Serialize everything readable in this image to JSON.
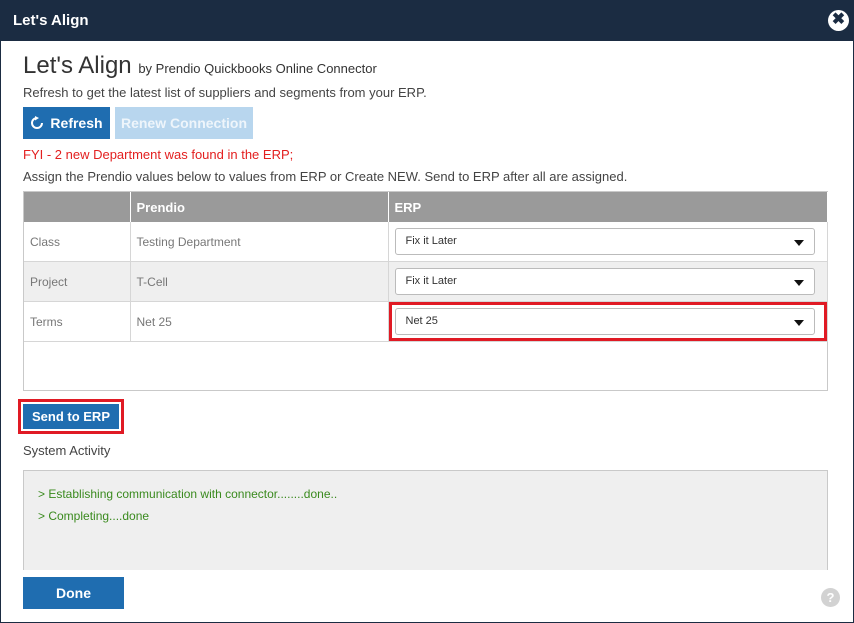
{
  "dialog": {
    "title": "Let's Align",
    "close_glyph": "✖",
    "close_icon": "close-icon"
  },
  "header": {
    "title": "Let's Align",
    "subtitle": "by Prendio Quickbooks Online Connector",
    "intro": "Refresh to get the latest list of suppliers and segments from your ERP."
  },
  "buttons": {
    "refresh_label": "Refresh",
    "refresh_icon": "refresh-icon",
    "renew_label": "Renew Connection",
    "send_label": "Send to ERP",
    "done_label": "Done",
    "help_label": "?"
  },
  "messages": {
    "fyi": "FYI - 2 new Department was found in the ERP;",
    "assign": "Assign the Prendio values below to values from ERP or Create NEW. Send to ERP after all are assigned."
  },
  "grid": {
    "columns": [
      "",
      "Prendio",
      "ERP"
    ],
    "rows": [
      {
        "type": "Class",
        "prendio": "Testing Department",
        "erp": "Fix it Later"
      },
      {
        "type": "Project",
        "prendio": "T-Cell",
        "erp": "Fix it Later"
      },
      {
        "type": "Terms",
        "prendio": "Net 25",
        "erp": "Net 25"
      }
    ]
  },
  "activity": {
    "label": "System Activity",
    "lines": [
      "> Establishing communication with connector........done..",
      "> Completing....done"
    ]
  },
  "colors": {
    "titlebar": "#1b2c42",
    "primary_button": "#1f6db0",
    "disabled_button": "#b8d6ee",
    "highlight": "#e01a24",
    "warning_text": "#e32020",
    "activity_text": "#3a8a1e"
  }
}
